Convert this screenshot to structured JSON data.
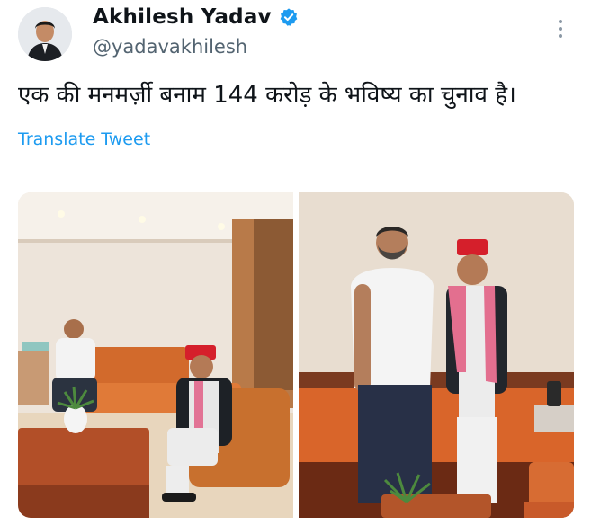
{
  "author": {
    "name": "Akhilesh Yadav",
    "handle": "@yadavakhilesh",
    "verified": true,
    "verified_color": "#1d9bf0"
  },
  "tweet": {
    "text": "एक की मनमर्ज़ी बनाम 144 करोड़ के भविष्य का चुनाव है।",
    "translate_label": "Translate Tweet"
  },
  "icons": {
    "more": "more-vertical-icon",
    "verified": "verified-badge-icon"
  },
  "media": {
    "count": 2
  },
  "colors": {
    "link": "#1d9bf0",
    "secondary_text": "#536471",
    "primary_text": "#0f1419"
  }
}
